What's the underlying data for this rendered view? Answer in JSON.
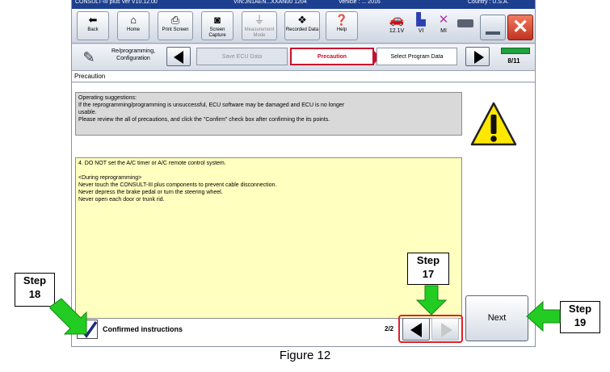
{
  "window": {
    "title_left": "CONSULT-III plus  Ver V10.12.00",
    "title_vin": "VIN:JN1AEN...XXAN00 1204",
    "title_vehicle": "Vehicle : ...   2016",
    "title_country": "Country : U.S.A."
  },
  "toolbar": {
    "buttons": [
      {
        "label": "Back",
        "icon": "back-arrow-icon"
      },
      {
        "label": "Home",
        "icon": "home-icon"
      },
      {
        "label": "Print Screen",
        "icon": "printer-icon"
      },
      {
        "label": "Screen Capture",
        "icon": "camera-icon"
      },
      {
        "label": "Measurement Mode",
        "icon": "measurement-icon"
      },
      {
        "label": "Recorded Data",
        "icon": "recorded-data-icon"
      },
      {
        "label": "Help",
        "icon": "help-icon"
      }
    ],
    "status": [
      {
        "label": "12.1V",
        "icon": "car-battery-icon"
      },
      {
        "label": "VI",
        "icon": "vi-icon"
      },
      {
        "label": "MI",
        "icon": "mi-icon"
      }
    ]
  },
  "nav": {
    "mode_label": "Re/programming, Configuration",
    "crumbs": [
      "Save ECU Data",
      "Precaution",
      "Select Program Data"
    ],
    "page_count": "8/11"
  },
  "page_title": "Precaution",
  "operating_suggestions": [
    "Operating  suggestions:",
    "If the reprogramming/programming is unsuccessful, ECU software may be damaged and ECU is no longer",
    "usable.",
    "Please review the all of precautions, and click the \"Confirm\" check box after confirming the its points."
  ],
  "precaution_text": [
    "4. DO NOT set the A/C timer or A/C remote control system.",
    "",
    "<During  reprogramming>",
    "Never touch the CONSULT-III plus components to prevent cable disconnection.",
    "Never depress the brake pedal or turn the steering wheel.",
    "Never open each door or trunk rid."
  ],
  "confirm": {
    "label": "Confirmed instructions",
    "checked": true
  },
  "pager": {
    "indicator": "2/2"
  },
  "next_button": "Next",
  "annotations": {
    "step18": [
      "Step",
      "18"
    ],
    "step17": [
      "Step",
      "17"
    ],
    "step19": [
      "Step",
      "19"
    ]
  },
  "caption": "Figure 12",
  "colors": {
    "highlight_red": "#e0202a",
    "arrow_green": "#22cc22",
    "precaution_bg": "#ffffbf",
    "title_bar": "#1d3f8f"
  }
}
